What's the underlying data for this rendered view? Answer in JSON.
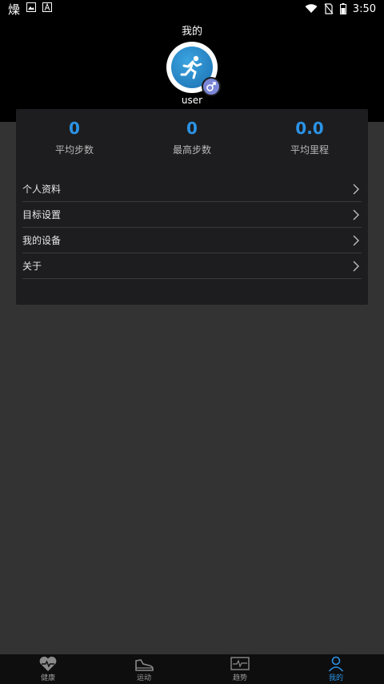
{
  "status_bar": {
    "time": "3:50",
    "left_icons": [
      "weather-icon",
      "image-icon",
      "font-icon"
    ],
    "right_icons": [
      "wifi-icon",
      "no-sim-icon",
      "battery-icon"
    ]
  },
  "header": {
    "title": "我的",
    "username": "user",
    "avatar_icon": "runner-icon",
    "gender_icon": "male-icon"
  },
  "stats": [
    {
      "value": "0",
      "label": "平均步数"
    },
    {
      "value": "0",
      "label": "最高步数"
    },
    {
      "value": "0.0",
      "label": "平均里程"
    }
  ],
  "menu": [
    {
      "label": "个人资料"
    },
    {
      "label": "目标设置"
    },
    {
      "label": "我的设备"
    },
    {
      "label": "关于"
    }
  ],
  "bottom_nav": [
    {
      "label": "健康",
      "icon": "heart-pulse-icon",
      "active": false
    },
    {
      "label": "运动",
      "icon": "shoe-icon",
      "active": false
    },
    {
      "label": "趋势",
      "icon": "trend-monitor-icon",
      "active": false
    },
    {
      "label": "我的",
      "icon": "user-icon",
      "active": true
    }
  ],
  "colors": {
    "accent": "#2b93e6",
    "card_bg": "#1d1d1f",
    "page_bg": "#333333",
    "header_bg": "#000000"
  }
}
